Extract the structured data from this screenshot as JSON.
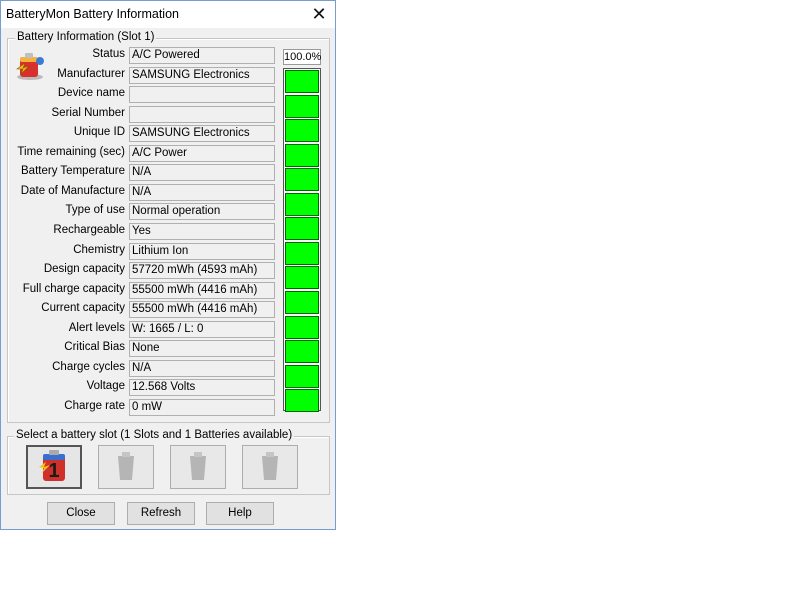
{
  "window": {
    "title": "BatteryMon Battery Information",
    "close_glyph": "✕"
  },
  "info_group": {
    "caption": "Battery Information (Slot 1)",
    "fields": [
      {
        "label": "Status",
        "value": "A/C Powered"
      },
      {
        "label": "Manufacturer",
        "value": "SAMSUNG Electronics"
      },
      {
        "label": "Device name",
        "value": ""
      },
      {
        "label": "Serial Number",
        "value": ""
      },
      {
        "label": "Unique ID",
        "value": "SAMSUNG Electronics"
      },
      {
        "label": "Time remaining (sec)",
        "value": "A/C Power"
      },
      {
        "label": "Battery Temperature",
        "value": "N/A"
      },
      {
        "label": "Date of Manufacture",
        "value": "N/A"
      },
      {
        "label": "Type of use",
        "value": "Normal operation"
      },
      {
        "label": "Rechargeable",
        "value": "Yes"
      },
      {
        "label": "Chemistry",
        "value": "Lithium Ion"
      },
      {
        "label": "Design capacity",
        "value": "57720 mWh (4593 mAh)"
      },
      {
        "label": "Full charge capacity",
        "value": "55500 mWh (4416 mAh)"
      },
      {
        "label": "Current capacity",
        "value": "55500 mWh (4416 mAh)"
      },
      {
        "label": "Alert levels",
        "value": "W: 1665 / L: 0"
      },
      {
        "label": "Critical Bias",
        "value": "None"
      },
      {
        "label": "Charge cycles",
        "value": "N/A"
      },
      {
        "label": "Voltage",
        "value": "12.568 Volts"
      },
      {
        "label": "Charge rate",
        "value": "0 mW"
      }
    ],
    "charge_percent_text": "100.0%",
    "charge_level": 1.0,
    "charge_color": "#00ff00",
    "icon": "battery-info-icon"
  },
  "slot_group": {
    "caption": "Select a battery slot (1 Slots and 1 Batteries available)",
    "slots": [
      {
        "icon": "battery-slot-1-icon",
        "active": true
      },
      {
        "icon": "battery-slot-empty-icon",
        "active": false
      },
      {
        "icon": "battery-slot-empty-icon",
        "active": false
      },
      {
        "icon": "battery-slot-empty-icon",
        "active": false
      }
    ]
  },
  "buttons": {
    "close": "Close",
    "refresh": "Refresh",
    "help": "Help"
  }
}
